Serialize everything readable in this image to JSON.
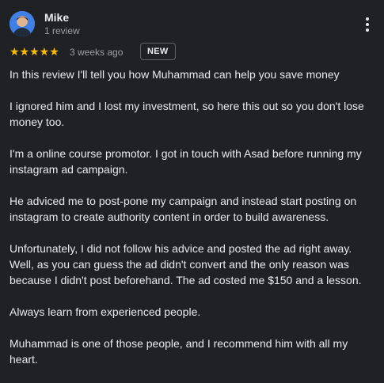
{
  "reviewer": {
    "name": "Mike",
    "review_count": "1 review",
    "avatar_icon": "person-avatar-icon"
  },
  "rating": {
    "stars": "★★★★★",
    "value": 5,
    "max": 5,
    "color": "#fbbc04"
  },
  "time_ago": "3 weeks ago",
  "badge": "NEW",
  "menu_icon": "more-vertical-icon",
  "review_paragraphs": [
    "In this review I'll tell you how Muhammad can help you save money",
    "I ignored him and I lost my investment, so here this out so you don't lose money too.",
    "I'm a online course promotor. I got in touch with Asad before running my instagram ad campaign.",
    "He adviced me to post-pone my campaign and instead start posting on instagram to create authority content in order to build awareness.",
    "Unfortunately, I did not follow his advice and posted the ad right away. Well, as you can guess the ad didn't convert and the only reason was because I didn't post beforehand. The ad costed me $150 and a lesson.",
    "Always learn from experienced people.",
    "Muhammad is one of those people, and I recommend him with all my heart."
  ]
}
